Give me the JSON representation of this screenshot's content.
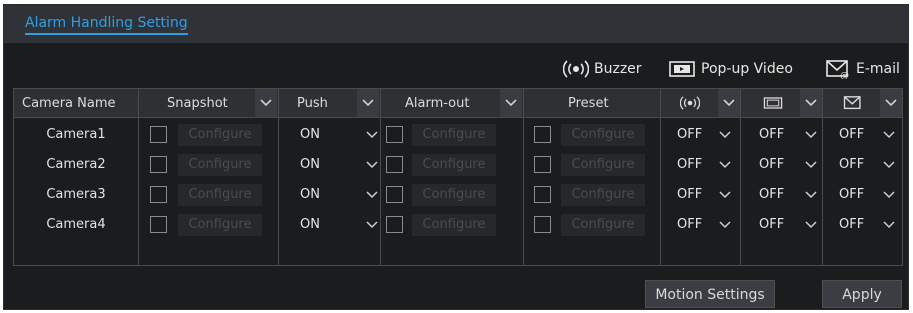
{
  "window": {
    "title": "Alarm Handling Setting"
  },
  "legend": {
    "buzzer": "Buzzer",
    "popup": "Pop-up Video",
    "email": "E-mail"
  },
  "table": {
    "headers": {
      "camera_name": "Camera Name",
      "snapshot": "Snapshot",
      "push": "Push",
      "alarm_out": "Alarm-out",
      "preset": "Preset"
    },
    "icons": {
      "buzzer": "buzzer-icon",
      "popup": "popup-video-icon",
      "email": "email-icon",
      "dropdown": "chevron-down-icon"
    },
    "configure_label": "Configure",
    "rows": [
      {
        "camera": "Camera1",
        "push": "ON",
        "buzzer": "OFF",
        "popup": "OFF",
        "email": "OFF"
      },
      {
        "camera": "Camera2",
        "push": "ON",
        "buzzer": "OFF",
        "popup": "OFF",
        "email": "OFF"
      },
      {
        "camera": "Camera3",
        "push": "ON",
        "buzzer": "OFF",
        "popup": "OFF",
        "email": "OFF"
      },
      {
        "camera": "Camera4",
        "push": "ON",
        "buzzer": "OFF",
        "popup": "OFF",
        "email": "OFF"
      }
    ]
  },
  "buttons": {
    "motion_settings": "Motion Settings",
    "apply": "Apply"
  },
  "colors": {
    "accent": "#2d9fe3",
    "panel": "#1b1c1e",
    "title_bar": "#2f3338"
  }
}
